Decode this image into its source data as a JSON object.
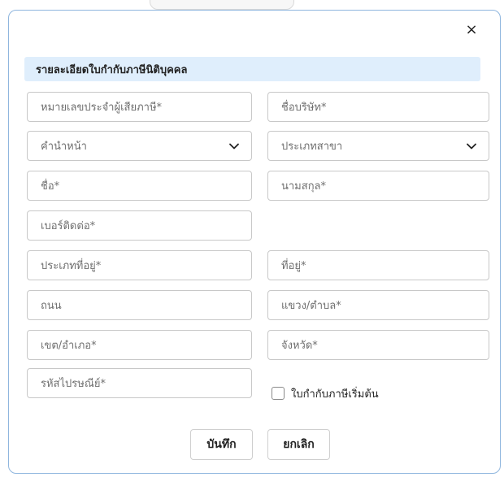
{
  "modal": {
    "close_symbol": "×",
    "title": "รายละเอียดใบกำกับภาษีนิติบุคคล"
  },
  "fields": {
    "tax_id": "หมายเลขประจำผู้เสียภาษี*",
    "company_name": "ชื่อบริษัท*",
    "prefix": "คำนำหน้า",
    "branch_type": "ประเภทสาขา",
    "first_name": "ชื่อ*",
    "last_name": "นามสกุล*",
    "phone": "เบอร์ติดต่อ*",
    "address_type": "ประเภทที่อยู่*",
    "address": "ที่อยู่*",
    "road": "ถนน",
    "subdistrict": "แขวง/ตำบล*",
    "district": "เขต/อำเภอ*",
    "province": "จังหวัด*",
    "postal_code": "รหัสไปรษณีย์*"
  },
  "checkbox": {
    "label": "ใบกำกับภาษีเริ่มต้น",
    "checked": false
  },
  "buttons": {
    "save": "บันทึก",
    "cancel": "ยกเลิก"
  },
  "colors": {
    "border_accent": "#8fb6de",
    "header_bg": "#dfeefc"
  }
}
